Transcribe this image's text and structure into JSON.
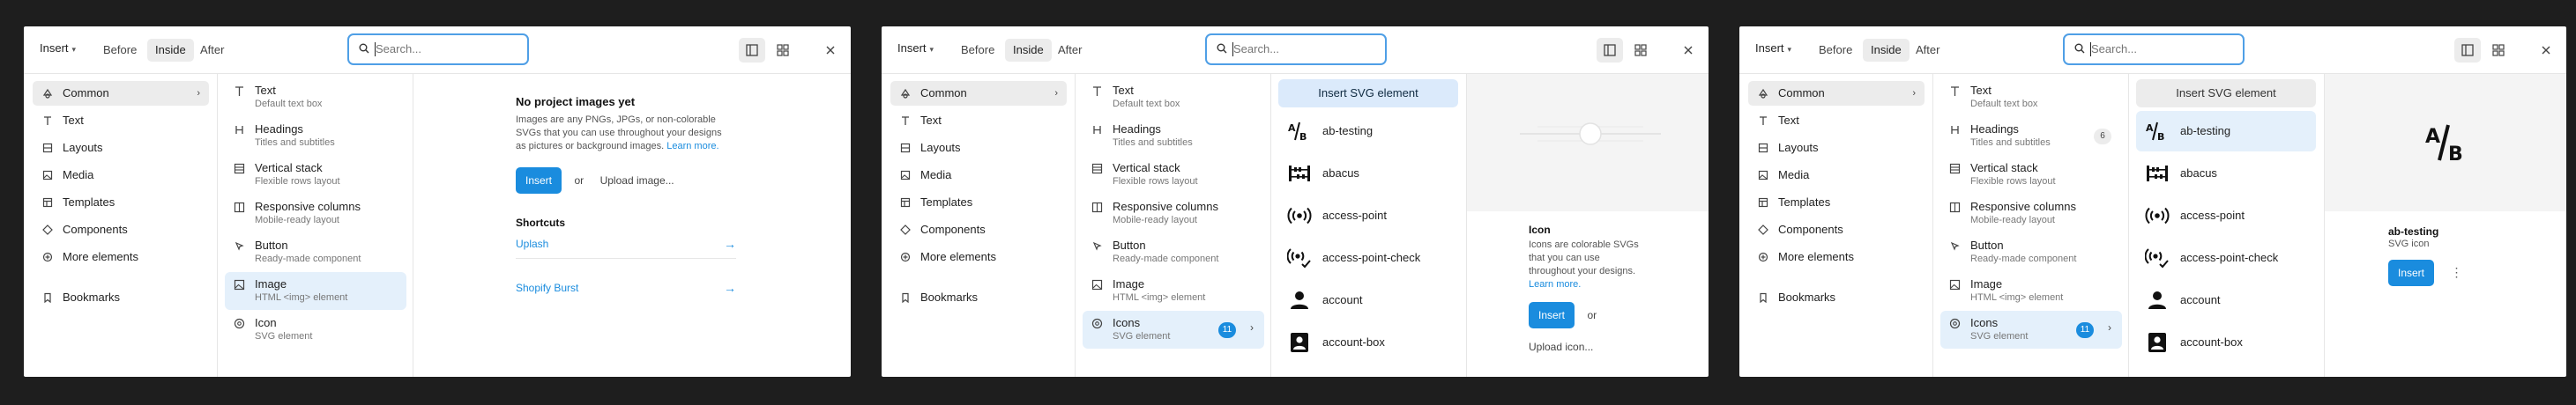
{
  "panels": [
    {
      "toolbar": {
        "insert": "Insert",
        "before": "Before",
        "inside": "Inside",
        "after": "After",
        "search_placeholder": "Search..."
      },
      "categories": [
        "Common",
        "Text",
        "Layouts",
        "Media",
        "Templates",
        "Components",
        "More elements",
        "Bookmarks"
      ],
      "elements": [
        {
          "title": "Text",
          "subtitle": "Default text box"
        },
        {
          "title": "Headings",
          "subtitle": "Titles and subtitles"
        },
        {
          "title": "Vertical stack",
          "subtitle": "Flexible rows layout"
        },
        {
          "title": "Responsive columns",
          "subtitle": "Mobile-ready layout"
        },
        {
          "title": "Button",
          "subtitle": "Ready-made component"
        },
        {
          "title": "Image",
          "subtitle": "HTML <img> element"
        },
        {
          "title": "Icon",
          "subtitle": "SVG element"
        }
      ],
      "detail": {
        "title": "No project images yet",
        "desc_1": "Images are any PNGs, JPGs, or non-colorable",
        "desc_2": "SVGs that you can use throughout your designs",
        "desc_3": "as pictures or background images.",
        "learn_more": "Learn more.",
        "insert": "Insert",
        "or": "or",
        "upload": "Upload image...",
        "shortcuts": "Shortcuts",
        "shortcut_1": "Uplash",
        "shortcut_2": "Shopify Burst"
      }
    },
    {
      "toolbar": {
        "insert": "Insert",
        "before": "Before",
        "inside": "Inside",
        "after": "After",
        "search_placeholder": "Search..."
      },
      "categories": [
        "Common",
        "Text",
        "Layouts",
        "Media",
        "Templates",
        "Components",
        "More elements",
        "Bookmarks"
      ],
      "elements": [
        {
          "title": "Text",
          "subtitle": "Default text box"
        },
        {
          "title": "Headings",
          "subtitle": "Titles and subtitles"
        },
        {
          "title": "Vertical stack",
          "subtitle": "Flexible rows layout"
        },
        {
          "title": "Responsive columns",
          "subtitle": "Mobile-ready layout"
        },
        {
          "title": "Button",
          "subtitle": "Ready-made component"
        },
        {
          "title": "Image",
          "subtitle": "HTML <img> element"
        },
        {
          "title": "Icons",
          "subtitle": "SVG element",
          "badge": "11"
        }
      ],
      "icons_header": "Insert SVG element",
      "icons": [
        "ab-testing",
        "abacus",
        "access-point",
        "access-point-check",
        "account",
        "account-box"
      ],
      "detail": {
        "title": "Icon",
        "desc_1": "Icons are colorable SVGs",
        "desc_2": "that you can use",
        "desc_3": "throughout your designs.",
        "learn_more": "Learn more.",
        "insert": "Insert",
        "or": "or",
        "upload": "Upload icon..."
      }
    },
    {
      "toolbar": {
        "insert": "Insert",
        "before": "Before",
        "inside": "Inside",
        "after": "After",
        "search_placeholder": "Search..."
      },
      "categories": [
        "Common",
        "Text",
        "Layouts",
        "Media",
        "Templates",
        "Components",
        "More elements",
        "Bookmarks"
      ],
      "elements": [
        {
          "title": "Text",
          "subtitle": "Default text box"
        },
        {
          "title": "Headings",
          "subtitle": "Titles and subtitles",
          "badge": "6"
        },
        {
          "title": "Vertical stack",
          "subtitle": "Flexible rows layout"
        },
        {
          "title": "Responsive columns",
          "subtitle": "Mobile-ready layout"
        },
        {
          "title": "Button",
          "subtitle": "Ready-made component"
        },
        {
          "title": "Image",
          "subtitle": "HTML <img> element"
        },
        {
          "title": "Icons",
          "subtitle": "SVG element",
          "badge": "11"
        }
      ],
      "icons_header": "Insert SVG element",
      "icons": [
        "ab-testing",
        "abacus",
        "access-point",
        "access-point-check",
        "account",
        "account-box"
      ],
      "detail": {
        "title": "ab-testing",
        "subtitle": "SVG icon",
        "insert": "Insert",
        "more": "⋮"
      }
    }
  ]
}
